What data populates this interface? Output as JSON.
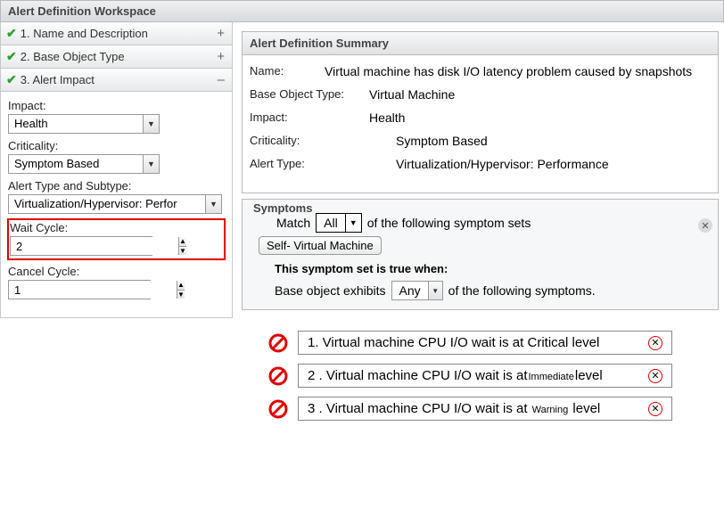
{
  "header": {
    "title": "Alert Definition Workspace"
  },
  "accordion": {
    "items": [
      {
        "label": "1. Name and Description",
        "toggle": "+"
      },
      {
        "label": "2. Base Object Type",
        "toggle": "+"
      },
      {
        "label": "3. Alert Impact",
        "toggle": "–"
      }
    ]
  },
  "form": {
    "impact_label": "Impact:",
    "impact_value": "Health",
    "criticality_label": "Criticality:",
    "criticality_value": "Symptom Based",
    "alerttype_label": "Alert Type and Subtype:",
    "alerttype_value": "Virtualization/Hypervisor: Perfor",
    "wait_label": "Wait Cycle:",
    "wait_value": "2",
    "cancel_label": "Cancel Cycle:",
    "cancel_value": "1"
  },
  "summary": {
    "title": "Alert Definition Summary",
    "rows": {
      "name_k": "Name:",
      "name_v": "Virtual machine has disk I/O latency problem caused by snapshots",
      "base_k": "Base Object Type:",
      "base_v": "Virtual Machine",
      "impact_k": "Impact:",
      "impact_v": "Health",
      "crit_k": "Criticality:",
      "crit_v": "Symptom Based",
      "type_k": "Alert Type:",
      "type_v": "Virtualization/Hypervisor: Performance"
    }
  },
  "symptoms": {
    "legend": "Symptoms",
    "match_label": "Match",
    "match_value": "All",
    "match_suffix": "of the following symptom sets",
    "pill": "Self- Virtual Machine",
    "rule_heading": "This symptom set is true when:",
    "rule_prefix": "Base object exhibits",
    "rule_value": "Any",
    "rule_suffix": "of the following symptoms."
  },
  "symptom_items": [
    {
      "n": "1.",
      "pre": " Virtual machine CPU I/O wait is at Critical level"
    },
    {
      "n": "2 .",
      "pre": " Virtual machine CPU I/O wait is at",
      "lvl": "Immediate",
      "post": "level"
    },
    {
      "n": "3 .",
      "pre": " Virtual machine CPU I/O wait is at ",
      "lvl": "Warning",
      "post": " level"
    }
  ]
}
